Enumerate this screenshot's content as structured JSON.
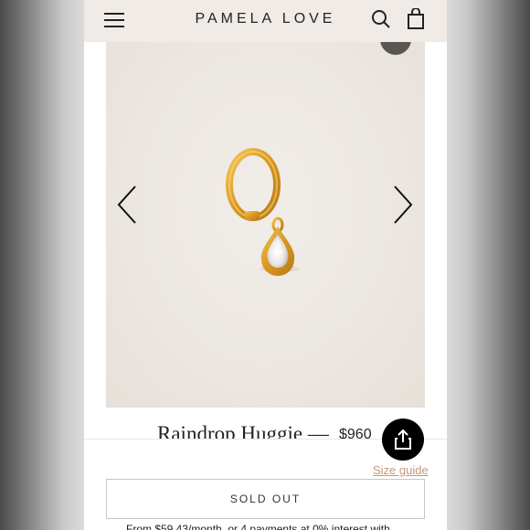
{
  "header": {
    "brand": "PAMELA LOVE",
    "icons": [
      "menu-icon",
      "search-icon",
      "shopping-bag-icon"
    ]
  },
  "gallery": {
    "icons": [
      "zoom-icon",
      "chevron-left-icon",
      "chevron-right-icon",
      "earring-image"
    ]
  },
  "product": {
    "title": "Raindrop Huggie",
    "separator": "—",
    "price": "$960"
  },
  "actions": {
    "share_icon": "share-icon",
    "share_color": "#000000",
    "size_guide": "Size guide",
    "size_guide_color": "#c9977a",
    "sold_out": "SOLD OUT",
    "financing": "From $59.43/month, or 4 payments at 0% interest with"
  },
  "colors": {
    "header_bg": "#f0ebe6",
    "gallery_bg": "#ece7e1",
    "gold": "#e0a02a"
  }
}
